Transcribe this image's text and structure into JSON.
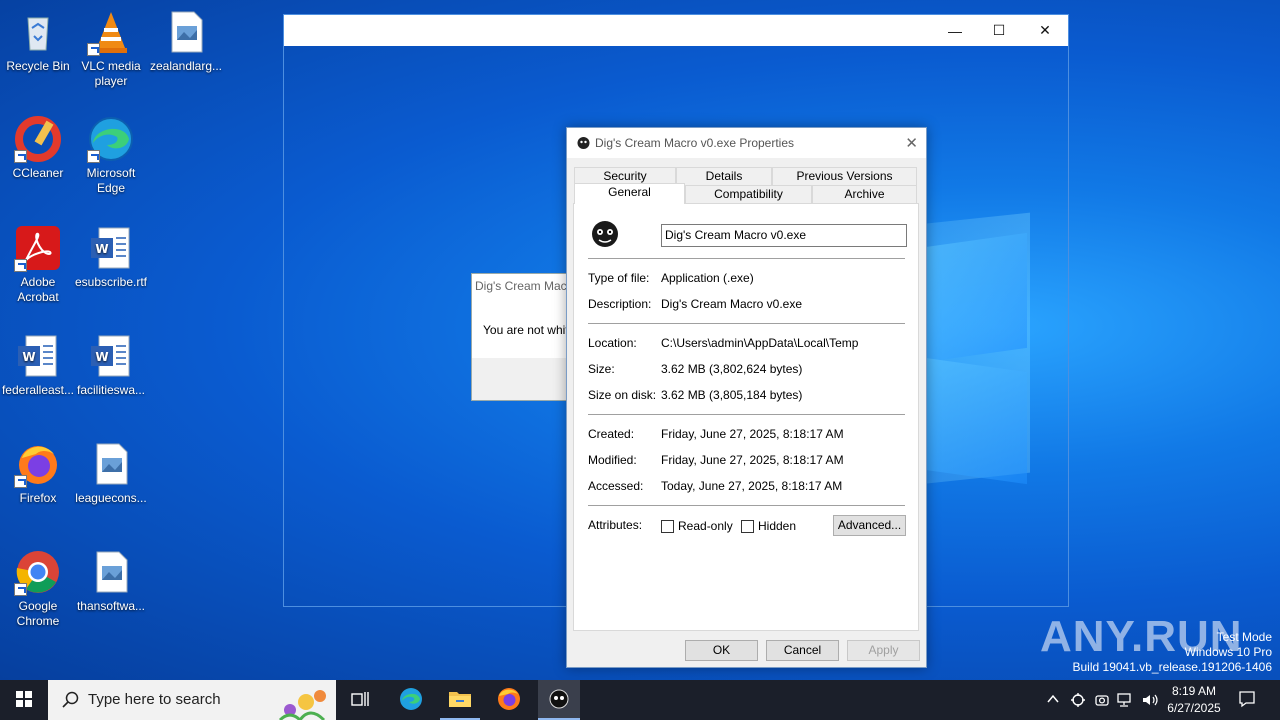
{
  "desktop": {
    "icons": [
      {
        "label": "Recycle Bin",
        "icon": "recycle-bin-icon"
      },
      {
        "label": "VLC media player",
        "icon": "vlc-icon"
      },
      {
        "label": "zealandlarg...",
        "icon": "image-file-icon"
      },
      {
        "label": "CCleaner",
        "icon": "ccleaner-icon"
      },
      {
        "label": "Microsoft Edge",
        "icon": "edge-icon"
      },
      {
        "label": "Adobe Acrobat",
        "icon": "acrobat-icon"
      },
      {
        "label": "esubscribe.rtf",
        "icon": "word-doc-icon"
      },
      {
        "label": "federalleast...",
        "icon": "word-doc-icon"
      },
      {
        "label": "facilitieswa...",
        "icon": "word-doc-icon"
      },
      {
        "label": "Firefox",
        "icon": "firefox-icon"
      },
      {
        "label": "leaguecons...",
        "icon": "image-file-icon"
      },
      {
        "label": "Google Chrome",
        "icon": "chrome-icon"
      },
      {
        "label": "thansoftwa...",
        "icon": "image-file-icon"
      }
    ]
  },
  "bg_window": {
    "minimize": "—",
    "maximize": "☐",
    "close": "✕"
  },
  "msgbox": {
    "title": "Dig's Cream Mac",
    "message": "You are not whit"
  },
  "props": {
    "title": "Dig's Cream Macro v0.exe Properties",
    "close": "✕",
    "tabs_top": [
      "Security",
      "Details",
      "Previous Versions"
    ],
    "tabs_bottom": [
      "General",
      "Compatibility",
      "Archive"
    ],
    "file_name": "Dig's Cream Macro v0.exe",
    "type_label": "Type of file:",
    "type_value": "Application (.exe)",
    "desc_label": "Description:",
    "desc_value": "Dig's Cream Macro v0.exe",
    "location_label": "Location:",
    "location_value": "C:\\Users\\admin\\AppData\\Local\\Temp",
    "size_label": "Size:",
    "size_value": "3.62 MB (3,802,624 bytes)",
    "size_disk_label": "Size on disk:",
    "size_disk_value": "3.62 MB (3,805,184 bytes)",
    "created_label": "Created:",
    "created_value": "Friday, June 27, 2025, 8:18:17 AM",
    "modified_label": "Modified:",
    "modified_value": "Friday, June 27, 2025, 8:18:17 AM",
    "accessed_label": "Accessed:",
    "accessed_value": "Today, June 27, 2025, 8:18:17 AM",
    "attributes_label": "Attributes:",
    "readonly_label": "Read-only",
    "hidden_label": "Hidden",
    "advanced_label": "Advanced...",
    "ok_label": "OK",
    "cancel_label": "Cancel",
    "apply_label": "Apply"
  },
  "watermark": {
    "brand": "ANY.RUN",
    "line1": "Test Mode",
    "line2": "Windows 10 Pro",
    "line3": "Build 19041.vb_release.191206-1406"
  },
  "taskbar": {
    "search_placeholder": "Type here to search",
    "time": "8:19 AM",
    "date": "6/27/2025"
  }
}
